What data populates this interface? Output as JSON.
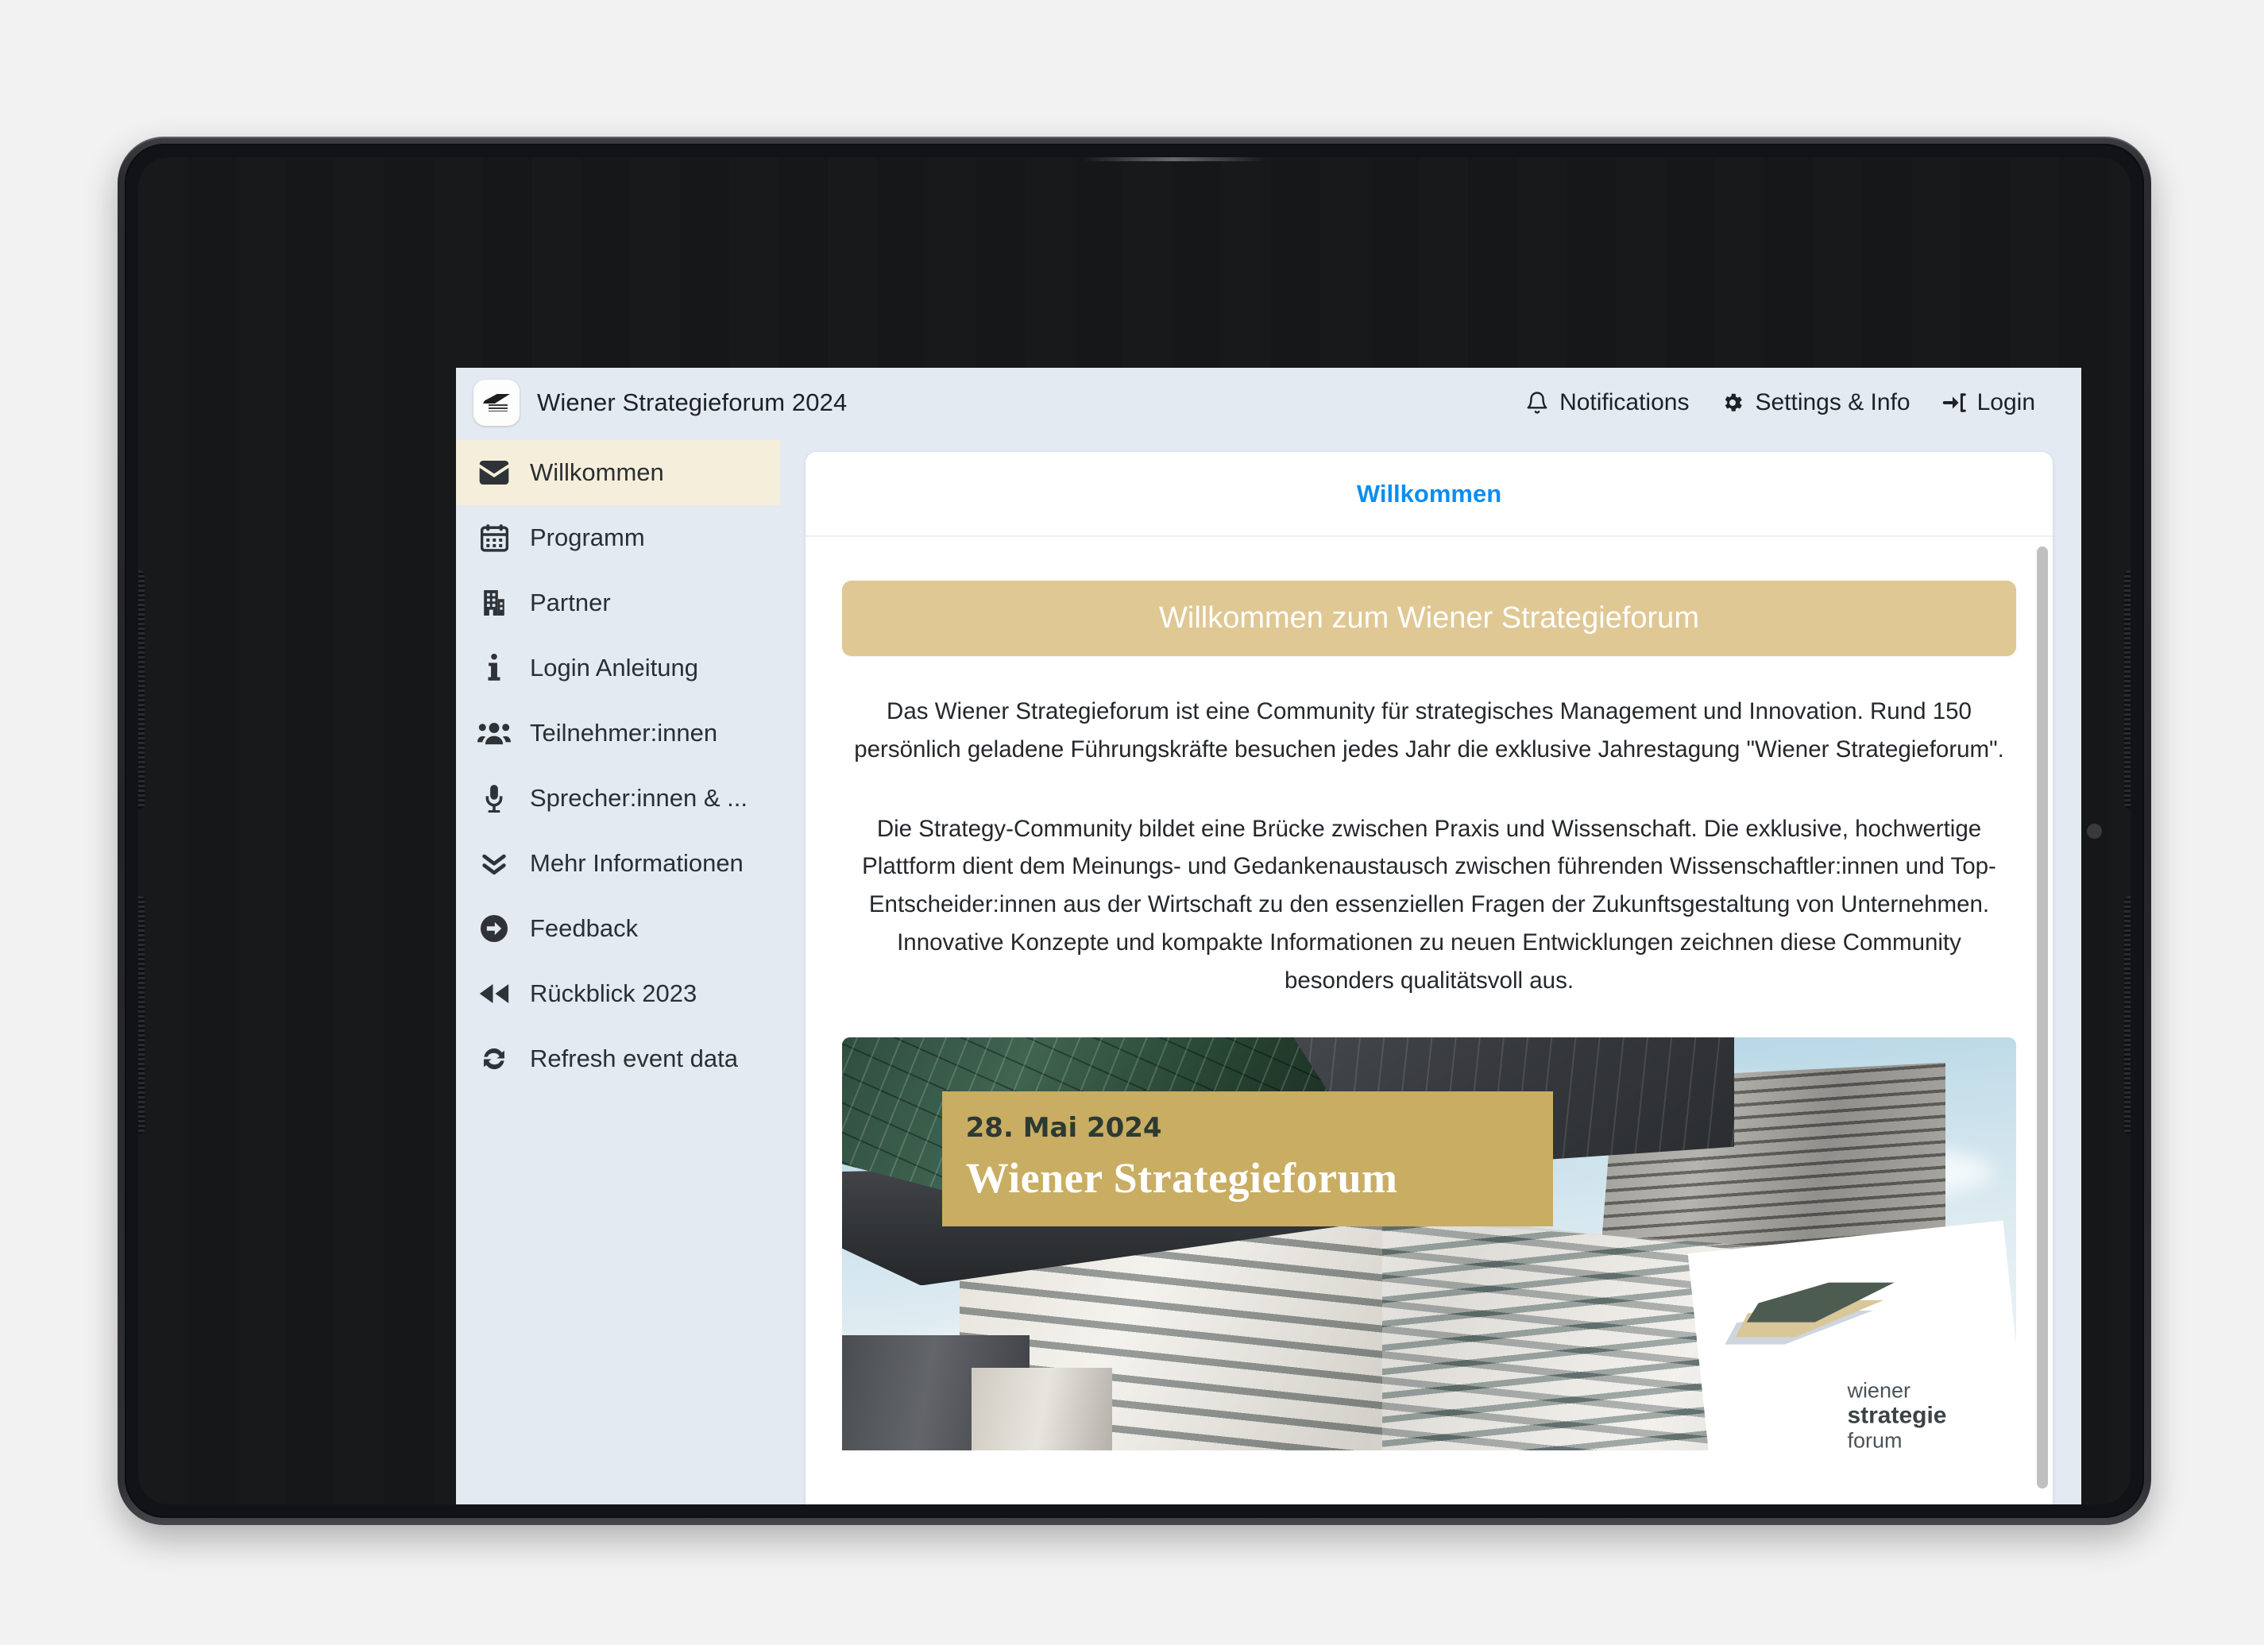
{
  "header": {
    "app_icon": "app-logo-icon",
    "title": "Wiener Strategieforum 2024",
    "actions": [
      {
        "icon": "bell-icon",
        "label": "Notifications"
      },
      {
        "icon": "gear-icon",
        "label": "Settings & Info"
      },
      {
        "icon": "login-arrow-icon",
        "label": "Login"
      }
    ]
  },
  "sidebar": {
    "items": [
      {
        "icon": "envelope-icon",
        "label": "Willkommen",
        "active": true
      },
      {
        "icon": "calendar-icon",
        "label": "Programm",
        "active": false
      },
      {
        "icon": "building-icon",
        "label": "Partner",
        "active": false
      },
      {
        "icon": "info-icon",
        "label": "Login Anleitung",
        "active": false
      },
      {
        "icon": "users-icon",
        "label": "Teilnehmer:innen",
        "active": false
      },
      {
        "icon": "microphone-icon",
        "label": "Sprecher:innen & ...",
        "active": false
      },
      {
        "icon": "chevron-double-down-icon",
        "label": "Mehr Informationen",
        "active": false
      },
      {
        "icon": "arrow-circle-right-icon",
        "label": "Feedback",
        "active": false
      },
      {
        "icon": "rewind-icon",
        "label": "Rückblick 2023",
        "active": false
      },
      {
        "icon": "refresh-icon",
        "label": "Refresh event data",
        "active": false
      }
    ]
  },
  "content": {
    "tab_label": "Willkommen",
    "hero_banner": "Willkommen zum Wiener Strategieforum",
    "paragraph_1": "Das Wiener Strategieforum ist eine Community für strategisches Management und Innovation. Rund 150 persönlich geladene Führungskräfte besuchen jedes Jahr die exklusive Jahrestagung \"Wiener Strategieforum\".",
    "paragraph_2": "Die Strategy-Community bildet eine Brücke zwischen Praxis und Wissenschaft. Die exklusive, hochwertige Plattform dient dem Meinungs- und Gedankenaustausch zwischen führenden Wissenschaftler:innen und Top-Entscheider:innen aus der Wirtschaft zu den essenziellen Fragen der Zukunftsgestaltung von Unternehmen. Innovative Konzepte und kompakte Informationen zu neuen Entwicklungen zeichnen diese Community besonders qualitätsvoll aus.",
    "picture": {
      "date": "28. Mai 2024",
      "title": "Wiener Strategieforum",
      "logo_line_1": "wiener",
      "logo_line_2": "strategie",
      "logo_line_3": "forum"
    }
  },
  "colors": {
    "accent_gold": "#e0c894",
    "label_gold": "#c9ad63",
    "active_nav": "#f5eeda",
    "app_background": "#e4eaf2",
    "tab_blue": "#0b8ef0",
    "logo_green": "#4d5c50"
  }
}
